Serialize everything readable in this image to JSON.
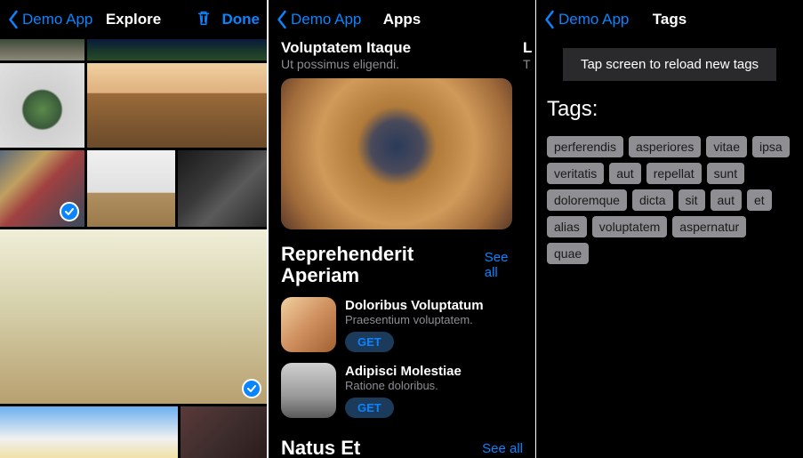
{
  "colors": {
    "accent": "#0a84ff",
    "background": "#000000",
    "secondaryText": "#8e8e93"
  },
  "panel1": {
    "back_label": "Demo App",
    "title": "Explore",
    "trash_icon": "trash-icon",
    "done_label": "Done",
    "tiles": [
      {
        "name": "photo-road",
        "selected": false
      },
      {
        "name": "photo-night-sky",
        "selected": false
      },
      {
        "name": "photo-cactus",
        "selected": false
      },
      {
        "name": "photo-fence",
        "selected": false
      },
      {
        "name": "photo-locks",
        "selected": true
      },
      {
        "name": "photo-tractor",
        "selected": false
      },
      {
        "name": "photo-car-interior",
        "selected": false
      },
      {
        "name": "photo-dreamcatcher",
        "selected": true
      },
      {
        "name": "photo-sky",
        "selected": false
      },
      {
        "name": "photo-portrait",
        "selected": false
      }
    ]
  },
  "panel2": {
    "back_label": "Demo App",
    "title": "Apps",
    "features": [
      {
        "title": "Voluptatem Itaque",
        "subtitle": "Ut possimus eligendi."
      },
      {
        "title": "L",
        "subtitle": "T"
      }
    ],
    "sections": [
      {
        "title": "Reprehenderit Aperiam",
        "see_all": "See all",
        "apps": [
          {
            "title": "Doloribus Voluptatum",
            "subtitle": "Praesentium voluptatem.",
            "action": "GET"
          },
          {
            "title": "Adipisci Molestiae",
            "subtitle": "Ratione doloribus.",
            "action": "GET"
          }
        ]
      },
      {
        "title": "Natus Et",
        "see_all": "See all",
        "apps": []
      }
    ]
  },
  "panel3": {
    "back_label": "Demo App",
    "title": "Tags",
    "reload_label": "Tap screen to reload new tags",
    "heading": "Tags:",
    "tags": [
      "perferendis",
      "asperiores",
      "vitae",
      "ipsa",
      "veritatis",
      "aut",
      "repellat",
      "sunt",
      "doloremque",
      "dicta",
      "sit",
      "aut",
      "et",
      "alias",
      "voluptatem",
      "aspernatur",
      "quae"
    ]
  }
}
